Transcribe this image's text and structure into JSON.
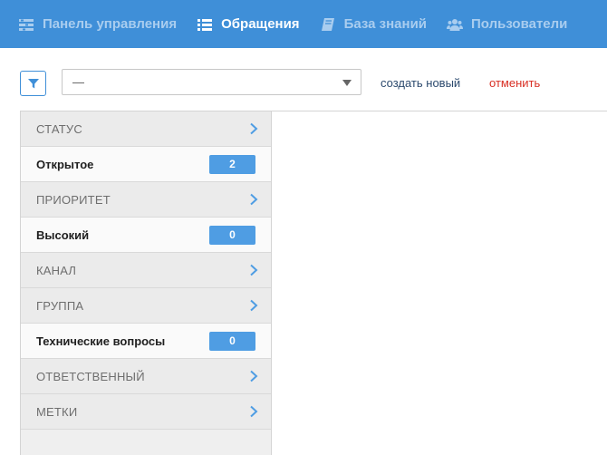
{
  "nav": {
    "items": [
      {
        "label": "Панель управления",
        "icon": "dashboard-icon",
        "active": false
      },
      {
        "label": "Обращения",
        "icon": "list-icon",
        "active": true
      },
      {
        "label": "База знаний",
        "icon": "book-icon",
        "active": false
      },
      {
        "label": "Пользователи",
        "icon": "users-icon",
        "active": false
      }
    ]
  },
  "toolbar": {
    "select_value": "—",
    "create_label": "создать новый",
    "cancel_label": "отменить"
  },
  "filters": {
    "status": {
      "label": "СТАТУС",
      "value": "Открытое",
      "count": "2"
    },
    "priority": {
      "label": "ПРИОРИТЕТ",
      "value": "Высокий",
      "count": "0"
    },
    "channel": {
      "label": "КАНАЛ"
    },
    "group": {
      "label": "ГРУППА",
      "value": "Технические вопросы",
      "count": "0"
    },
    "assignee": {
      "label": "ОТВЕТСТВЕННЫЙ"
    },
    "tags": {
      "label": "МЕТКИ"
    }
  },
  "colors": {
    "nav_bg": "#3f8fd8",
    "accent": "#4f9de3",
    "cancel": "#d93025"
  }
}
